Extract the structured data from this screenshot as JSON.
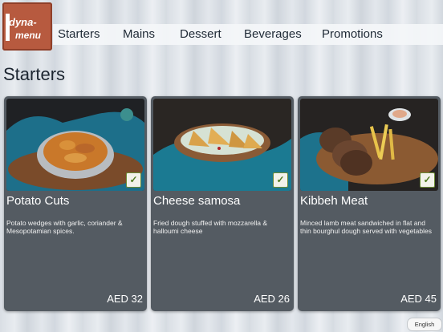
{
  "logo": {
    "line1": "dyna-",
    "line2": "menu"
  },
  "nav": {
    "items": [
      {
        "label": "Starters"
      },
      {
        "label": "Mains"
      },
      {
        "label": "Dessert"
      },
      {
        "label": "Beverages"
      },
      {
        "label": "Promotions"
      }
    ]
  },
  "page": {
    "title": "Starters"
  },
  "cards": [
    {
      "name": "Potato Cuts",
      "description": "Potato wedges with garlic, coriander & Mesopotamian spices.",
      "price": "AED 32",
      "veg_icon": "vegetarian-leaf-icon"
    },
    {
      "name": "Cheese samosa",
      "description": "Fried dough stuffed with mozzarella & halloumi cheese",
      "price": "AED 26",
      "veg_icon": "vegetarian-leaf-icon"
    },
    {
      "name": "Kibbeh Meat",
      "description": "Minced lamb meat sandwiched in flat and thin bourghul dough served with vegetables",
      "price": "AED 45",
      "veg_icon": "vegetarian-leaf-icon"
    }
  ],
  "language": {
    "label": "English"
  }
}
